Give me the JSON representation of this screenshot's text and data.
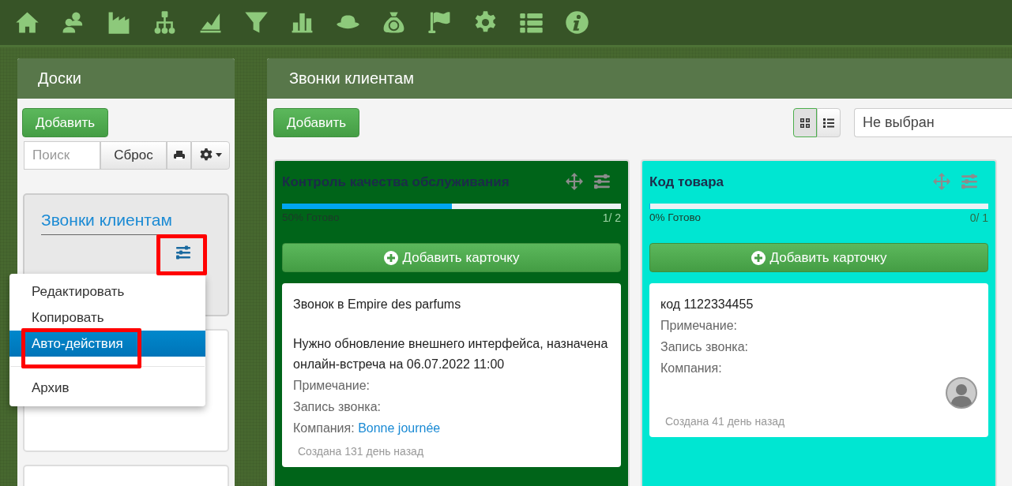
{
  "boards_panel": {
    "title": "Доски",
    "add_button": "Добавить",
    "search": {
      "placeholder": "Поиск"
    },
    "reset_button": "Сброс",
    "boards": [
      {
        "title": "Звонки клиентам",
        "selected": true
      },
      {
        "selected": false
      },
      {
        "selected": false
      }
    ]
  },
  "menu": {
    "items": [
      {
        "kind": "item",
        "label": "Редактировать",
        "selected": false
      },
      {
        "kind": "item",
        "label": "Копировать",
        "selected": false
      },
      {
        "kind": "item",
        "label": "Авто-действия",
        "selected": true
      },
      {
        "kind": "divider"
      },
      {
        "kind": "item",
        "label": "Архив",
        "selected": false
      }
    ]
  },
  "board": {
    "title": "Звонки клиентам",
    "add_button": "Добавить",
    "view_toggle": [
      {
        "kind": "grid",
        "selected": true
      },
      {
        "kind": "list",
        "selected": false
      }
    ],
    "filter_select": {
      "value": "Не выбран"
    },
    "columns": [
      {
        "title": "Контроль качества обслуживания",
        "color": "#006419",
        "level": 0.5,
        "progress_label": "50% Готово",
        "count": "1/ 2",
        "add_card_button": "Добавить карточку",
        "cards": [
          {
            "title": "Звонок в Empire des parfums",
            "description": "Нужно обновление внешнего интерфейса, назначена онлайн-встреча на 06.07.2022 11:00",
            "fields": [
              {
                "label": "Примечание:"
              },
              {
                "label": "Запись звонка:"
              },
              {
                "label": "Компания:",
                "value": "Bonne journée"
              }
            ],
            "avatar": false,
            "created": "Создана 131 день назад"
          }
        ]
      },
      {
        "title": "Код товара",
        "color": "#00e6d2",
        "level": 0,
        "progress_label": "0% Готово",
        "count": "0/ 1",
        "add_card_button": "Добавить карточку",
        "cards": [
          {
            "title": "код 1122334455",
            "fields": [
              {
                "label": "Примечание:"
              },
              {
                "label": "Запись звонка:"
              },
              {
                "label": "Компания:"
              }
            ],
            "avatar": true,
            "created": "Создана 41 день назад"
          }
        ]
      }
    ]
  }
}
